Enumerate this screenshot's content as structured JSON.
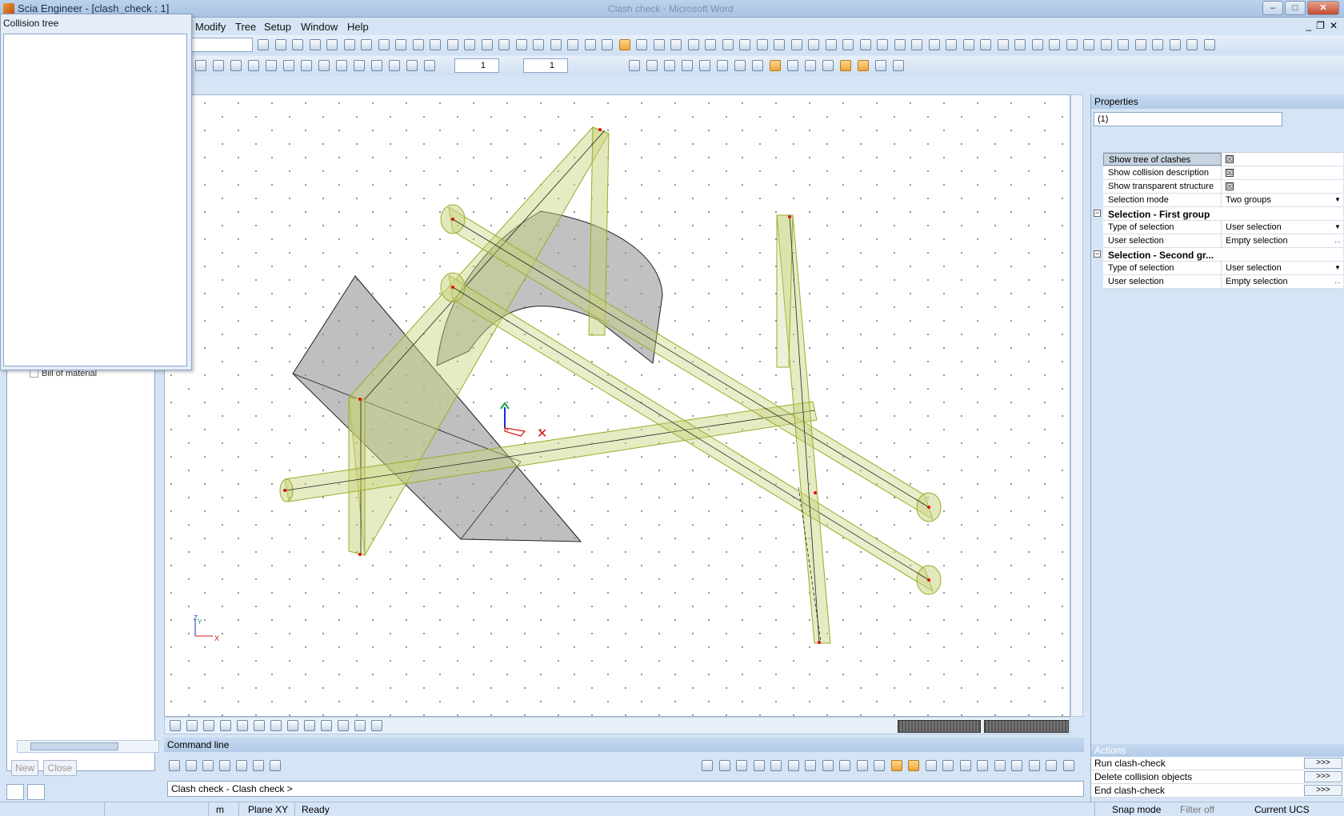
{
  "window": {
    "title": "Scia Engineer - [clash_check : 1]",
    "center_title": "Clash check - Microsoft Word"
  },
  "menu": [
    "Modify",
    "Tree",
    "Setup",
    "Window",
    "Help"
  ],
  "collision_tree": {
    "title": "Collision tree"
  },
  "left_panel": {
    "bom_label": "Bill of material",
    "new_label": "New",
    "close_label": "Close"
  },
  "toolbar": {
    "spin1_value": "1",
    "spin2_value": "1"
  },
  "properties": {
    "title": "Properties",
    "selected": "(1)",
    "rows": [
      {
        "name": "Show tree of clashes",
        "check": "☒"
      },
      {
        "name": "Show collision description",
        "check": "☒"
      },
      {
        "name": "Show transparent structure",
        "check": "☒"
      },
      {
        "name": "Selection mode",
        "value": "Two groups"
      },
      {
        "group": "Selection - First group"
      },
      {
        "name": "Type of selection",
        "value": "User selection"
      },
      {
        "name": "User selection",
        "value": "Empty selection"
      },
      {
        "group": "Selection - Second gr..."
      },
      {
        "name": "Type of selection",
        "value": "User selection"
      },
      {
        "name": "User selection",
        "value": "Empty selection"
      }
    ]
  },
  "actions": {
    "title": "Actions",
    "items": [
      {
        "label": "Run clash-check",
        "go": ">>>"
      },
      {
        "label": "Delete collision objects",
        "go": ">>>"
      },
      {
        "label": "End clash-check",
        "go": ">>>"
      }
    ]
  },
  "command_line": {
    "title": "Command line",
    "value": "Clash check - Clash check >"
  },
  "status_bar": {
    "unit": "m",
    "plane": "Plane XY",
    "state": "Ready",
    "snap": "Snap mode",
    "filter": "Filter off",
    "ucs": "Current UCS"
  },
  "axes": {
    "z": "Z",
    "y": "Y",
    "x": "X"
  }
}
